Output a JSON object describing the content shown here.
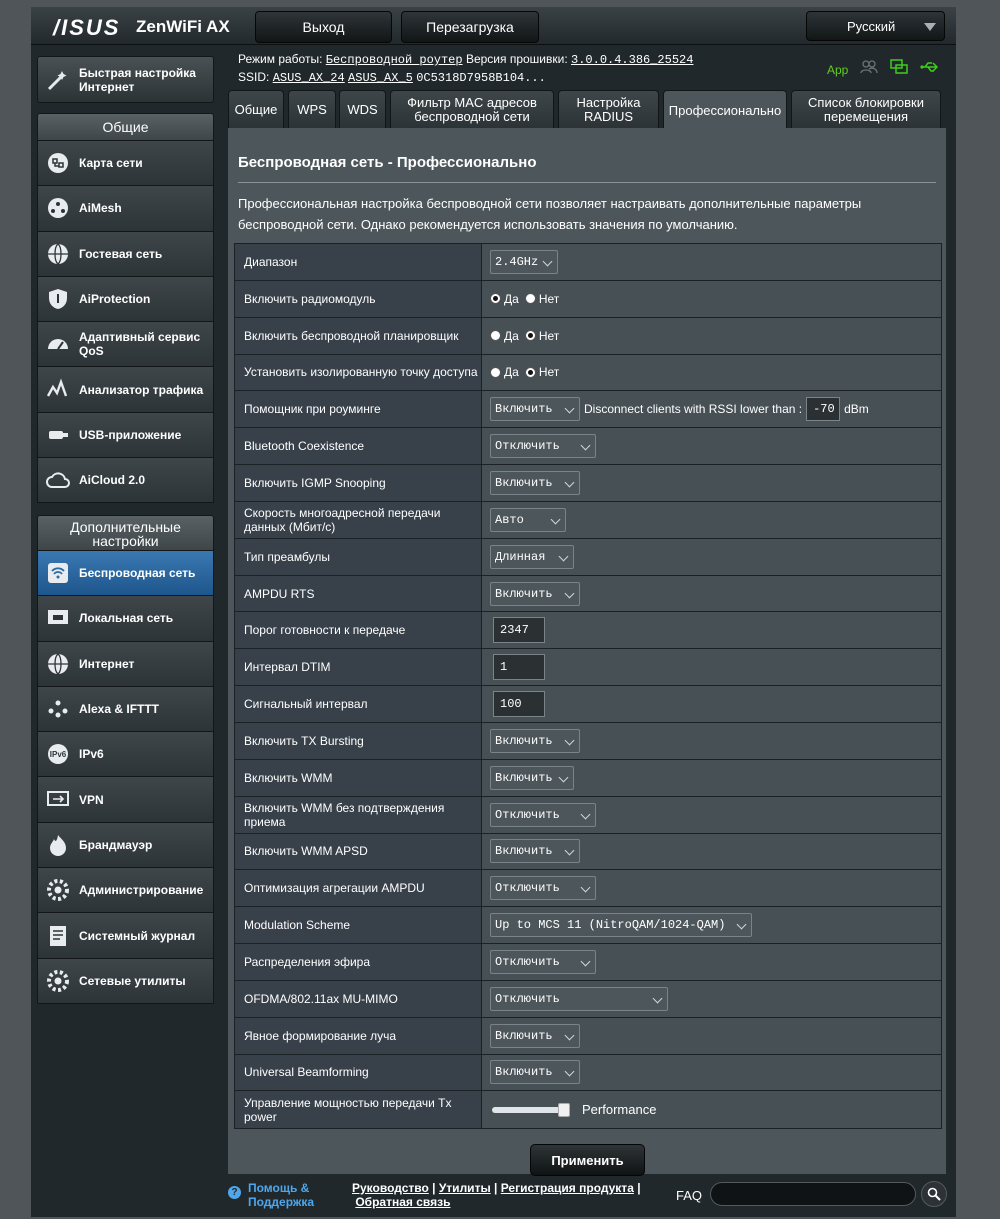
{
  "header": {
    "brand": "/ISUS",
    "model": "ZenWiFi AX",
    "logout_label": "Выход",
    "reboot_label": "Перезагрузка",
    "language": "Русский"
  },
  "status": {
    "mode_label": "Режим работы:",
    "mode_value": "Беспроводной роутер",
    "fw_label": "Версия прошивки:",
    "fw_value": "3.0.0.4.386_25524",
    "ssid_label": "SSID:",
    "ssid_1": "ASUS_AX_24",
    "ssid_2": "ASUS_AX_5",
    "mac": "0C5318D7958B104...",
    "app_label": "App"
  },
  "sidebar": {
    "quick_setup": "Быстрая настройка Интернет",
    "general_head": "Общие",
    "general_items": [
      {
        "label": "Карта сети",
        "icon": "network-map-icon"
      },
      {
        "label": "AiMesh",
        "icon": "aimesh-icon"
      },
      {
        "label": "Гостевая сеть",
        "icon": "guest-network-icon"
      },
      {
        "label": "AiProtection",
        "icon": "shield-icon"
      },
      {
        "label": "Адаптивный сервис QoS",
        "icon": "speedometer-icon"
      },
      {
        "label": "Анализатор трафика",
        "icon": "traffic-analyzer-icon"
      },
      {
        "label": "USB-приложение",
        "icon": "usb-icon"
      },
      {
        "label": "AiCloud 2.0",
        "icon": "cloud-icon"
      }
    ],
    "advanced_head": "Дополнительные настройки",
    "advanced_items": [
      {
        "label": "Беспроводная сеть",
        "icon": "wireless-icon",
        "active": true
      },
      {
        "label": "Локальная сеть",
        "icon": "lan-icon"
      },
      {
        "label": "Интернет",
        "icon": "globe-icon"
      },
      {
        "label": "Alexa & IFTTT",
        "icon": "alexa-icon"
      },
      {
        "label": "IPv6",
        "icon": "ipv6-icon"
      },
      {
        "label": "VPN",
        "icon": "vpn-icon"
      },
      {
        "label": "Брандмауэр",
        "icon": "firewall-icon"
      },
      {
        "label": "Администрирование",
        "icon": "administration-icon"
      },
      {
        "label": "Системный журнал",
        "icon": "system-log-icon"
      },
      {
        "label": "Сетевые утилиты",
        "icon": "network-tools-icon"
      }
    ]
  },
  "tabs": [
    "Общие",
    "WPS",
    "WDS",
    "Фильтр MAC адресов беспроводной сети",
    "Настройка RADIUS",
    "Профессионально",
    "Список блокировки перемещения"
  ],
  "main": {
    "title": "Беспроводная сеть - Профессионально",
    "description": "Профессиональная настройка беспроводной сети позволяет настраивать дополнительные параметры беспроводной сети. Однако рекомендуется использовать значения по умолчанию.",
    "yes": "Да",
    "no": "Нет",
    "roaming_text": "Disconnect clients with RSSI lower than :",
    "roaming_value": "-70",
    "roaming_unit": "dBm",
    "tx_power_label": "Performance",
    "tx_power_level": 1.0,
    "apply_label": "Применить",
    "rows": [
      {
        "label": "Диапазон",
        "type": "select",
        "value": "2.4GHz"
      },
      {
        "label": "Включить радиомодуль",
        "type": "radio",
        "value": "yes"
      },
      {
        "label": "Включить беспроводной планировщик",
        "type": "radio",
        "value": "no"
      },
      {
        "label": "Установить изолированную точку доступа",
        "type": "radio",
        "value": "no"
      },
      {
        "label": "Помощник при роуминге",
        "type": "roaming",
        "value": "Включить"
      },
      {
        "label": "Bluetooth Coexistence",
        "type": "select",
        "value": "Отключить"
      },
      {
        "label": "Включить IGMP Snooping",
        "type": "select",
        "value": "Включить"
      },
      {
        "label": "Скорость многоадресной передачи данных (Мбит/с)",
        "type": "select",
        "value": "Авто"
      },
      {
        "label": "Тип преамбулы",
        "type": "select",
        "value": "Длинная"
      },
      {
        "label": "AMPDU RTS",
        "type": "select",
        "value": "Включить"
      },
      {
        "label": "Порог готовности к передаче",
        "type": "input",
        "value": "2347"
      },
      {
        "label": "Интервал DTIM",
        "type": "input",
        "value": "1"
      },
      {
        "label": "Сигнальный интервал",
        "type": "input",
        "value": "100"
      },
      {
        "label": "Включить TX Bursting",
        "type": "select",
        "value": "Включить"
      },
      {
        "label": "Включить WMM",
        "type": "select",
        "value": "Включить"
      },
      {
        "label": "Включить WMM без подтверждения приема",
        "type": "select",
        "value": "Отключить"
      },
      {
        "label": "Включить WMM APSD",
        "type": "select",
        "value": "Включить"
      },
      {
        "label": "Оптимизация агрегации AMPDU",
        "type": "select",
        "value": "Отключить"
      },
      {
        "label": "Modulation Scheme",
        "type": "select",
        "value": "Up to MCS 11 (NitroQAM/1024-QAM)"
      },
      {
        "label": "Распределения эфира",
        "type": "select",
        "value": "Отключить"
      },
      {
        "label": "OFDMA/802.11ax MU-MIMO",
        "type": "select",
        "value": "Отключить"
      },
      {
        "label": "Явное формирование луча",
        "type": "select",
        "value": "Включить"
      },
      {
        "label": "Universal Beamforming",
        "type": "select",
        "value": "Включить"
      },
      {
        "label": "Управление мощностью передачи Tx power",
        "type": "slider",
        "value": ""
      }
    ]
  },
  "footer": {
    "help_line1": "Помощь &",
    "help_line2": "Поддержка",
    "manual": "Руководство",
    "utilities": "Утилиты",
    "registration": "Регистрация продукта",
    "feedback": "Обратная связь",
    "faq": "FAQ",
    "search_placeholder": ""
  }
}
